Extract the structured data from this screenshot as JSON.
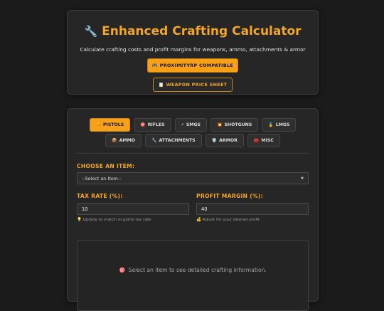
{
  "header": {
    "title_icon": "🔧",
    "title": "Enhanced Crafting Calculator",
    "subtitle": "Calculate crafting costs and profit margins for weapons, ammo, attachments & armor",
    "compat_icon": "🎮",
    "compat_label": "PROXIMITYRP COMPATIBLE",
    "price_icon": "📋",
    "price_label": "WEAPON PRICE SHEET"
  },
  "tabs_row1": [
    {
      "icon": "🔫",
      "label": "PISTOLS"
    },
    {
      "icon": "🎯",
      "label": "RIFLES"
    },
    {
      "icon": "⚡",
      "label": "SMGS"
    },
    {
      "icon": "💥",
      "label": "SHOTGUNS"
    },
    {
      "icon": "🏅",
      "label": "LMGS"
    }
  ],
  "tabs_row2": [
    {
      "icon": "📦",
      "label": "AMMO"
    },
    {
      "icon": "🔧",
      "label": "ATTACHMENTS"
    },
    {
      "icon": "🛡️",
      "label": "ARMOR"
    },
    {
      "icon": "🧰",
      "label": "MISC"
    }
  ],
  "form": {
    "item_label": "CHOOSE AN ITEM:",
    "item_selected": "--Select an Item--",
    "caret": "▼",
    "tax_label": "TAX RATE (%):",
    "tax_value": "10",
    "tax_hint_icon": "💡",
    "tax_hint": "Update to match in-game tax rate",
    "profit_label": "PROFIT MARGIN (%):",
    "profit_value": "40",
    "profit_hint_icon": "💰",
    "profit_hint": "Adjust for your desired profit"
  },
  "info": {
    "icon": "🎯",
    "text": "Select an item to see detailed crafting information."
  },
  "colors": {
    "accent": "#f7a11a",
    "background": "#1b1b1b",
    "card": "#262626"
  }
}
